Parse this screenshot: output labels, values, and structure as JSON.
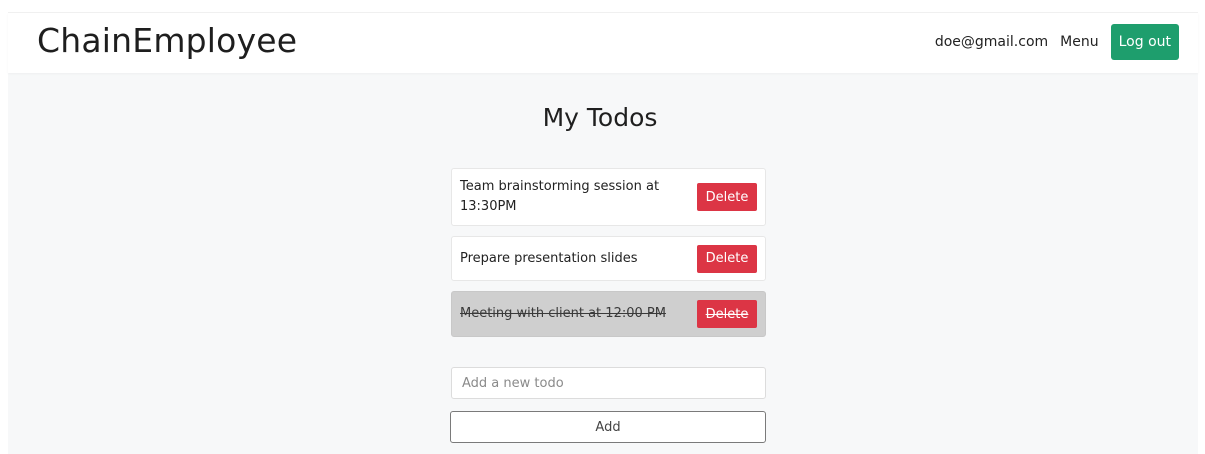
{
  "navbar": {
    "brand": "ChainEmployee",
    "email": "doe@gmail.com",
    "menu_label": "Menu",
    "logout_label": "Log out",
    "logout_color": "#1e9e6d"
  },
  "main": {
    "title": "My Todos",
    "todos": [
      {
        "text": "Team brainstorming session at 13:30PM",
        "completed": false,
        "delete_label": "Delete"
      },
      {
        "text": "Prepare presentation slides",
        "completed": false,
        "delete_label": "Delete"
      },
      {
        "text": "Meeting with client at 12:00 PM",
        "completed": true,
        "delete_label": "Delete"
      }
    ],
    "new_todo_placeholder": "Add a new todo",
    "new_todo_value": "",
    "add_label": "Add",
    "delete_color": "#dc3545"
  }
}
